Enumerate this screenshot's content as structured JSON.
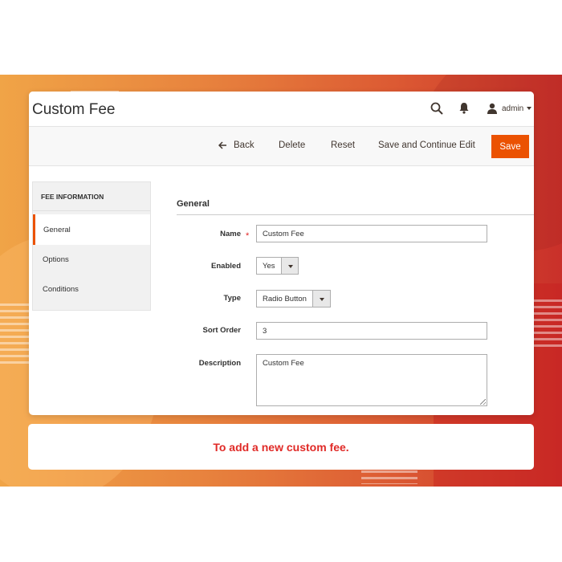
{
  "page": {
    "title": "Custom Fee",
    "user": "admin",
    "icons": [
      "search-icon",
      "bell-icon",
      "user-icon",
      "chevron-down-icon",
      "arrow-left-icon"
    ]
  },
  "actions": {
    "back": "Back",
    "delete": "Delete",
    "reset": "Reset",
    "save_continue": "Save and Continue Edit",
    "save": "Save"
  },
  "sidebar": {
    "heading": "FEE INFORMATION",
    "items": [
      {
        "label": "General",
        "active": true
      },
      {
        "label": "Options",
        "active": false
      },
      {
        "label": "Conditions",
        "active": false
      }
    ]
  },
  "form": {
    "section_title": "General",
    "name_label": "Name",
    "name_required_mark": "*",
    "name_value": "Custom Fee",
    "enabled_label": "Enabled",
    "enabled_value": "Yes",
    "type_label": "Type",
    "type_value": "Radio Button",
    "sort_order_label": "Sort Order",
    "sort_order_value": "3",
    "description_label": "Description",
    "description_value": "Custom Fee"
  },
  "caption": "To add a new custom fee.",
  "colors": {
    "accent": "#eb5202",
    "caption": "#e02a27",
    "bg_start": "#f0a447",
    "bg_end": "#c9302a"
  }
}
